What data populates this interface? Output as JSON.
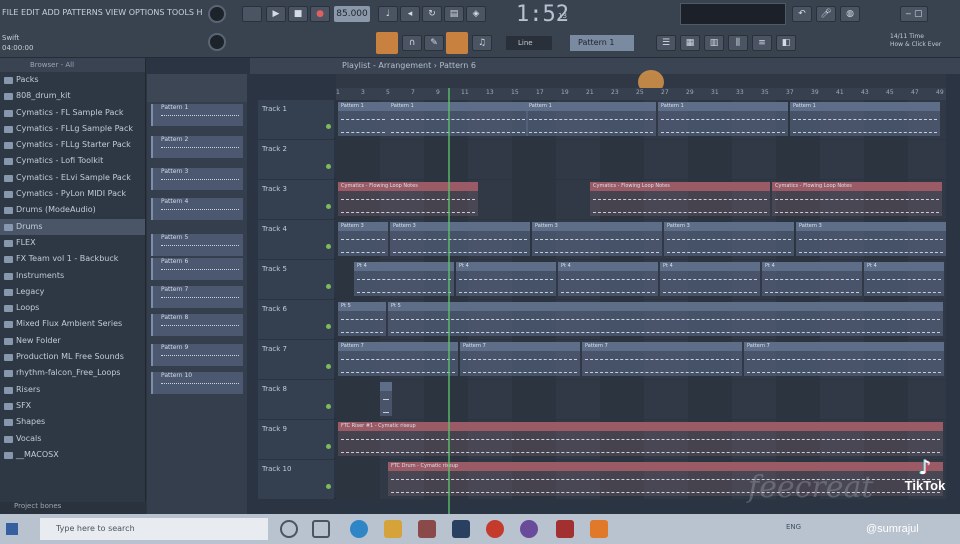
{
  "colors": {
    "background": "#2b3442",
    "clip": "#5f6e88",
    "accent_orange": "#c98140",
    "playhead": "#5bbf6a",
    "tiktok_cyan": "#25f4ee",
    "tiktok_red": "#fe2c55"
  },
  "topbar": {
    "title": "FILE EDIT ADD PATTERNS VIEW OPTIONS TOOLS HELP",
    "tempo": "85.000",
    "time": "1:52",
    "time_small": "13",
    "pattern": "Pattern 1",
    "snap": "Line",
    "hint1": "Swift",
    "hint2": "04:00:00",
    "info_line1": "14/11 Time",
    "info_line2": "How & Click Ever"
  },
  "browser": {
    "header": "Browser - All",
    "items": [
      {
        "label": "Packs"
      },
      {
        "label": "808_drum_kit"
      },
      {
        "label": "Cymatics - FL Sample Pack"
      },
      {
        "label": "Cymatics - FLLg Sample Pack"
      },
      {
        "label": "Cymatics - FLLg Starter Pack"
      },
      {
        "label": "Cymatics - Lofi Toolkit"
      },
      {
        "label": "Cymatics - ELvi Sample Pack"
      },
      {
        "label": "Cymatics - PyLon MIDI Pack"
      },
      {
        "label": "Drums (ModeAudio)"
      },
      {
        "label": "Drums"
      },
      {
        "label": "FLEX"
      },
      {
        "label": "FX Team vol 1 - Backbuck"
      },
      {
        "label": "Instruments"
      },
      {
        "label": "Legacy"
      },
      {
        "label": "Loops"
      },
      {
        "label": "Mixed Flux Ambient Series"
      },
      {
        "label": "New Folder"
      },
      {
        "label": "Production ML Free Sounds"
      },
      {
        "label": "rhythm-falcon_Free_Loops"
      },
      {
        "label": "Risers"
      },
      {
        "label": "SFX"
      },
      {
        "label": "Shapes"
      },
      {
        "label": "Vocals"
      },
      {
        "label": "__MACOSX"
      }
    ],
    "footer": "Project bones"
  },
  "picker": {
    "patterns": [
      "Pattern 1",
      "Pattern 2",
      "Pattern 3",
      "Pattern 4",
      "Pattern 5",
      "Pattern 6",
      "Pattern 7",
      "Pattern 8",
      "Pattern 9",
      "Pattern 10"
    ]
  },
  "playlist": {
    "title": "Playlist - Arrangement › Pattern 6",
    "ruler": [
      "1",
      "3",
      "5",
      "7",
      "9",
      "11",
      "13",
      "15",
      "17",
      "19",
      "21",
      "23",
      "25",
      "27",
      "29",
      "31",
      "33",
      "35",
      "37",
      "39",
      "41",
      "43",
      "45",
      "47",
      "49"
    ],
    "tracks": [
      {
        "name": "Track 1",
        "clips": [
          {
            "label": "Pattern 1",
            "red": false
          },
          {
            "label": "Pattern 1",
            "red": false
          },
          {
            "label": "Pattern 1",
            "red": false
          },
          {
            "label": "Pattern 1",
            "red": false
          },
          {
            "label": "Pattern 1",
            "red": false
          }
        ]
      },
      {
        "name": "Track 2",
        "clips": []
      },
      {
        "name": "Track 3",
        "clips": [
          {
            "label": "Cymatics - Flowing Loop Notes",
            "red": true
          },
          {
            "label": "Cymatics - Flowing Loop Notes",
            "red": true
          },
          {
            "label": "Cymatics - Flowing Loop Notes",
            "red": true
          }
        ]
      },
      {
        "name": "Track 4",
        "clips": [
          {
            "label": "Pattern 3",
            "red": false
          },
          {
            "label": "Pattern 3",
            "red": false
          },
          {
            "label": "Pattern 3",
            "red": false
          },
          {
            "label": "Pattern 3",
            "red": false
          },
          {
            "label": "Pattern 3",
            "red": false
          }
        ]
      },
      {
        "name": "Track 5",
        "clips": [
          {
            "label": "Pt 4",
            "red": false
          },
          {
            "label": "Pt 4",
            "red": false
          },
          {
            "label": "Pt 4",
            "red": false
          },
          {
            "label": "Pt 4",
            "red": false
          },
          {
            "label": "Pt 4",
            "red": false
          },
          {
            "label": "Pt 4",
            "red": false
          }
        ]
      },
      {
        "name": "Track 6",
        "clips": [
          {
            "label": "Pt 5",
            "red": false
          },
          {
            "label": "Pt 5",
            "red": false
          }
        ]
      },
      {
        "name": "Track 7",
        "clips": [
          {
            "label": "Pattern 7",
            "red": false
          },
          {
            "label": "Pattern 7",
            "red": false
          },
          {
            "label": "Pattern 7",
            "red": false
          },
          {
            "label": "Pattern 7",
            "red": false
          }
        ]
      },
      {
        "name": "Track 8",
        "clips": [
          {
            "label": "",
            "red": false
          }
        ]
      },
      {
        "name": "Track 9",
        "clips": [
          {
            "label": "FTC Riser #1 - Cymatic riseup",
            "red": true
          }
        ]
      },
      {
        "name": "Track 10",
        "clips": [
          {
            "label": "FTC Drum - Cymatic riseup",
            "red": true
          }
        ]
      }
    ]
  },
  "taskbar": {
    "search_placeholder": "Type here to search",
    "tray": "ENG"
  },
  "overlay": {
    "watermark": "feecreat",
    "brand": "TikTok",
    "username": "@sumrajul"
  }
}
